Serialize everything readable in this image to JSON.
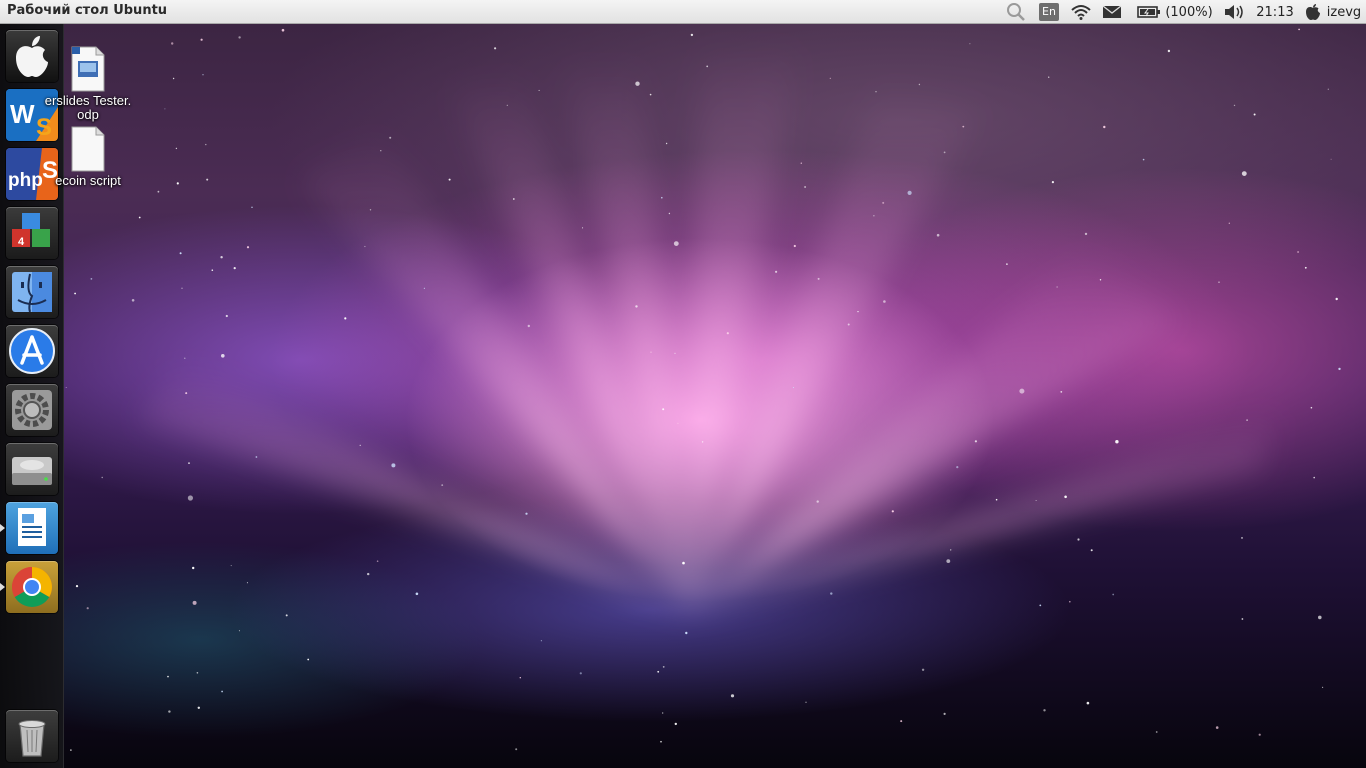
{
  "top_panel": {
    "window_title": "Рабочий стол Ubuntu",
    "keyboard_layout": "En",
    "battery": "(100%)",
    "clock": "21:13",
    "username": "izevg",
    "icons": [
      "search-icon",
      "wifi-icon",
      "mail-icon",
      "battery-icon",
      "volume-icon",
      "apple-icon"
    ]
  },
  "launcher": {
    "items": [
      {
        "name": "apple",
        "running": false
      },
      {
        "name": "webstorm",
        "running": false
      },
      {
        "name": "phpstorm",
        "running": false
      },
      {
        "name": "cubes",
        "running": false
      },
      {
        "name": "finder",
        "running": false
      },
      {
        "name": "app-store",
        "running": false
      },
      {
        "name": "system-preferences",
        "running": false
      },
      {
        "name": "hard-drive",
        "running": false
      },
      {
        "name": "writer",
        "running": true
      },
      {
        "name": "chrome",
        "running": true
      }
    ],
    "trash": "trash-icon"
  },
  "desktop_icons": [
    {
      "label_line1": "erslides Tester.",
      "label_line2": "odp",
      "icon": "presentation-file-icon"
    },
    {
      "label_line1": "ecoin script",
      "label_line2": "",
      "icon": "text-file-icon"
    }
  ],
  "colors": {
    "panel": "#e6e6e6",
    "launcher": "#141416",
    "accent_pink": "#ff9de6"
  }
}
